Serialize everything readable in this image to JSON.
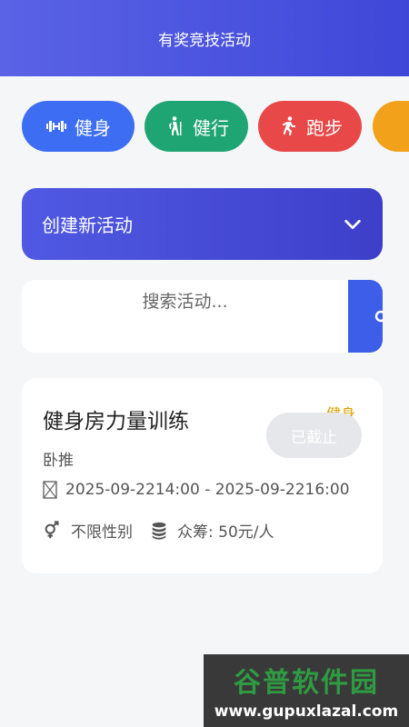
{
  "header": {
    "title": "有奖竞技活动"
  },
  "categories": [
    {
      "label": "健身",
      "color": "#3d6df2",
      "icon": "dumbbell-icon"
    },
    {
      "label": "健行",
      "color": "#1fa573",
      "icon": "hiking-icon"
    },
    {
      "label": "跑步",
      "color": "#e84848",
      "icon": "running-icon"
    },
    {
      "label": "",
      "color": "#f2a21a",
      "icon": ""
    }
  ],
  "create": {
    "label": "创建新活动",
    "icon": "chevron-down-icon"
  },
  "search": {
    "placeholder": "搜索活动...",
    "value": "",
    "icon": "search-icon"
  },
  "activities": [
    {
      "title": "健身房力量训练",
      "tag": "健身",
      "status": "已截止",
      "subtitle": "卧推",
      "time": "2025-09-2214:00 - 2025-09-2216:00",
      "gender": "不限性别",
      "fee": "众筹: 50元/人"
    }
  ],
  "watermark": {
    "brand": "谷普软件园",
    "url": "www.gupuxlazal.com"
  }
}
